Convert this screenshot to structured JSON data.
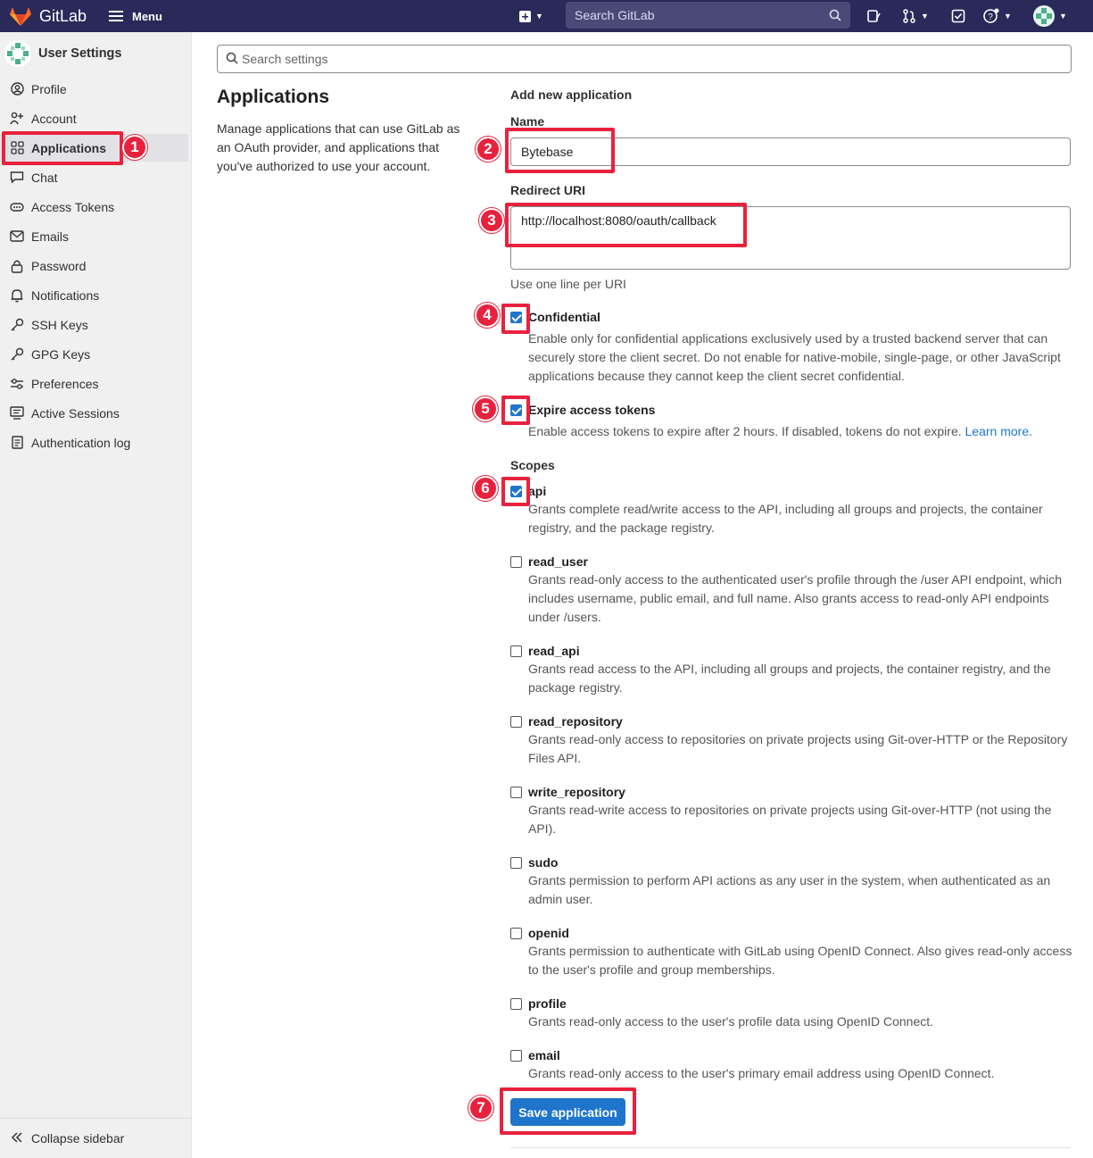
{
  "topbar": {
    "app_name": "GitLab",
    "menu_label": "Menu",
    "search_placeholder": "Search GitLab"
  },
  "sidebar": {
    "title": "User Settings",
    "items": [
      {
        "label": "Profile",
        "icon": "profile-icon"
      },
      {
        "label": "Account",
        "icon": "account-icon"
      },
      {
        "label": "Applications",
        "icon": "applications-icon",
        "active": true
      },
      {
        "label": "Chat",
        "icon": "chat-icon"
      },
      {
        "label": "Access Tokens",
        "icon": "token-icon"
      },
      {
        "label": "Emails",
        "icon": "mail-icon"
      },
      {
        "label": "Password",
        "icon": "lock-icon"
      },
      {
        "label": "Notifications",
        "icon": "bell-icon"
      },
      {
        "label": "SSH Keys",
        "icon": "key-icon"
      },
      {
        "label": "GPG Keys",
        "icon": "key-icon"
      },
      {
        "label": "Preferences",
        "icon": "preferences-icon"
      },
      {
        "label": "Active Sessions",
        "icon": "monitor-icon"
      },
      {
        "label": "Authentication log",
        "icon": "log-icon"
      }
    ],
    "collapse_label": "Collapse sidebar"
  },
  "settings_search": {
    "placeholder": "Search settings"
  },
  "page": {
    "title": "Applications",
    "description": "Manage applications that can use GitLab as an OAuth provider, and applications that you've authorized to use your account."
  },
  "form": {
    "section_title": "Add new application",
    "name_label": "Name",
    "name_value": "Bytebase",
    "redirect_label": "Redirect URI",
    "redirect_value": "http://localhost:8080/oauth/callback",
    "redirect_hint": "Use one line per URI",
    "confidential": {
      "label": "Confidential",
      "checked": true,
      "description": "Enable only for confidential applications exclusively used by a trusted backend server that can securely store the client secret. Do not enable for native-mobile, single-page, or other JavaScript applications because they cannot keep the client secret confidential."
    },
    "expire": {
      "label": "Expire access tokens",
      "checked": true,
      "description": "Enable access tokens to expire after 2 hours. If disabled, tokens do not expire.",
      "link": "Learn more."
    },
    "scopes_label": "Scopes",
    "scopes": [
      {
        "name": "api",
        "checked": true,
        "description": "Grants complete read/write access to the API, including all groups and projects, the container registry, and the package registry."
      },
      {
        "name": "read_user",
        "checked": false,
        "description": "Grants read-only access to the authenticated user's profile through the /user API endpoint, which includes username, public email, and full name. Also grants access to read-only API endpoints under /users."
      },
      {
        "name": "read_api",
        "checked": false,
        "description": "Grants read access to the API, including all groups and projects, the container registry, and the package registry."
      },
      {
        "name": "read_repository",
        "checked": false,
        "description": "Grants read-only access to repositories on private projects using Git-over-HTTP or the Repository Files API."
      },
      {
        "name": "write_repository",
        "checked": false,
        "description": "Grants read-write access to repositories on private projects using Git-over-HTTP (not using the API)."
      },
      {
        "name": "sudo",
        "checked": false,
        "description": "Grants permission to perform API actions as any user in the system, when authenticated as an admin user."
      },
      {
        "name": "openid",
        "checked": false,
        "description": "Grants permission to authenticate with GitLab using OpenID Connect. Also gives read-only access to the user's profile and group memberships."
      },
      {
        "name": "profile",
        "checked": false,
        "description": "Grants read-only access to the user's profile data using OpenID Connect."
      },
      {
        "name": "email",
        "checked": false,
        "description": "Grants read-only access to the user's primary email address using OpenID Connect."
      }
    ],
    "save_label": "Save application"
  },
  "annotations": [
    "1",
    "2",
    "3",
    "4",
    "5",
    "6",
    "7"
  ],
  "colors": {
    "navbar": "#29295a",
    "primary": "#1f75cb",
    "highlight": "#e8223e"
  }
}
